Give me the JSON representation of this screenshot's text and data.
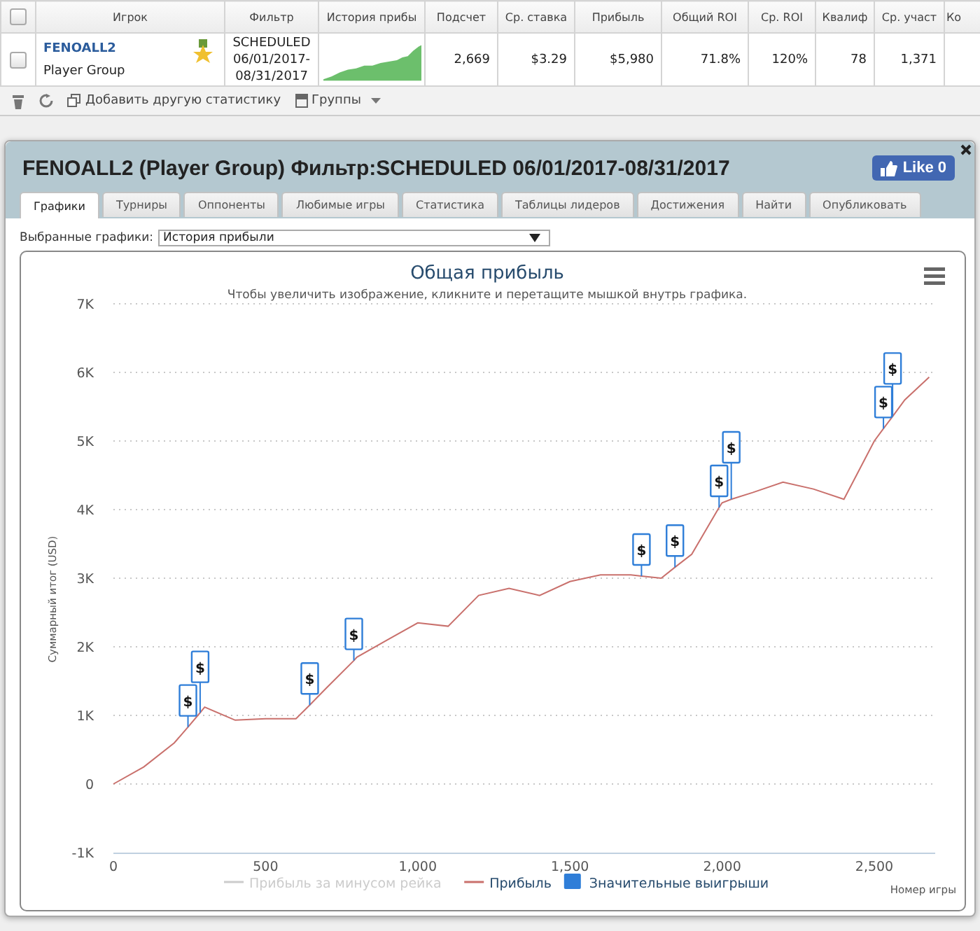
{
  "table": {
    "header_checked": false,
    "columns": [
      "Игрок",
      "Фильтр",
      "История прибы",
      "Подсчет",
      "Ср. ставка",
      "Прибыль",
      "Общий ROI",
      "Ср. ROI",
      "Квалиф",
      "Ср. участ",
      "Ко"
    ],
    "rows": [
      {
        "checked": false,
        "cells": [
          {
            "kind": "player",
            "name": "FENOALL2",
            "group": "Player Group"
          },
          {
            "kind": "filter",
            "lines": [
              "SCHEDULED",
              "06/01/2017-",
              "08/31/2017"
            ]
          },
          {
            "kind": "sparkline"
          },
          {
            "kind": "text",
            "text": "2,669"
          },
          {
            "kind": "text",
            "text": "$3.29"
          },
          {
            "kind": "text",
            "text": "$5,980"
          },
          {
            "kind": "text",
            "text": "71.8%"
          },
          {
            "kind": "text",
            "text": "120%"
          },
          {
            "kind": "text",
            "text": "78"
          },
          {
            "kind": "text",
            "text": "1,371"
          }
        ]
      }
    ]
  },
  "toolbar": [
    {
      "kind": "trash"
    },
    {
      "kind": "refresh"
    },
    {
      "kind": "add",
      "label": "Добавить другую статистику"
    },
    {
      "kind": "groups",
      "label": "Группы"
    }
  ],
  "dialog": {
    "title": "FENOALL2 (Player Group) Фильтр:SCHEDULED 06/01/2017-08/31/2017",
    "like": "Like 0",
    "tabs": [
      {
        "label": "Графики",
        "selected": true
      },
      {
        "label": "Турниры",
        "selected": false
      },
      {
        "label": "Оппоненты",
        "selected": false
      },
      {
        "label": "Любимые игры",
        "selected": false
      },
      {
        "label": "Статистика",
        "selected": false
      },
      {
        "label": "Таблицы лидеров",
        "selected": false
      },
      {
        "label": "Достижения",
        "selected": false
      },
      {
        "label": "Найти",
        "selected": false
      },
      {
        "label": "Опубликовать",
        "selected": false
      }
    ],
    "selector": {
      "label": "Выбранные графики:",
      "value": "История прибыли"
    },
    "chart": {
      "legend_items": [
        {
          "label": "Прибыль за минусом рейка",
          "kind": "line",
          "enabled": false
        },
        {
          "kind": "series",
          "enabled": true
        },
        {
          "label": "Значительные выигрыши",
          "kind": "flag",
          "enabled": true,
          "color": "#2f7ed8"
        }
      ],
      "chart_data": {
        "type": "line",
        "title": "Общая прибыль",
        "subtitle": "Чтобы увеличить изображение, кликните и перетащите мышкой внутрь графика.",
        "xlabel": "Номер игры",
        "ylabel": "Суммарный итог (USD)",
        "grid": true,
        "legend": "bottom",
        "x": [
          0,
          100,
          200,
          245,
          285,
          300,
          400,
          500,
          600,
          645,
          700,
          790,
          800,
          900,
          1000,
          1100,
          1200,
          1300,
          1400,
          1500,
          1600,
          1700,
          1735,
          1800,
          1845,
          1900,
          1990,
          2000,
          2030,
          2100,
          2200,
          2300,
          2400,
          2500,
          2530,
          2560,
          2600,
          2680
        ],
        "series": [
          {
            "name": "Прибыль",
            "color": "#c9706c",
            "values": [
              0,
              250,
              600,
              830,
              1040,
              1120,
              930,
              950,
              950,
              1150,
              1400,
              1800,
              1850,
              2100,
              2350,
              2300,
              2750,
              2850,
              2750,
              2950,
              3050,
              3050,
              3030,
              3000,
              3160,
              3350,
              4030,
              4100,
              4150,
              4250,
              4400,
              4300,
              4150,
              5000,
              5180,
              5360,
              5600,
              5930
            ]
          }
        ],
        "xlim": [
          0,
          2700
        ],
        "ylim": [
          -1000,
          7000
        ],
        "xticks": [
          0,
          500,
          {
            "value": 1000,
            "label": "1,000"
          },
          {
            "value": 1500,
            "label": "1,500"
          },
          {
            "value": 2000,
            "label": "2,000"
          },
          {
            "value": 2500,
            "label": "2,500"
          }
        ],
        "yticks": [
          {
            "value": -1000,
            "label": "-1K"
          },
          0,
          {
            "value": 1000,
            "label": "1K"
          },
          {
            "value": 2000,
            "label": "2K"
          },
          {
            "value": 3000,
            "label": "3K"
          },
          {
            "value": 4000,
            "label": "4K"
          },
          {
            "value": 5000,
            "label": "5K"
          },
          {
            "value": 6000,
            "label": "6K"
          },
          {
            "value": 7000,
            "label": "7K"
          }
        ],
        "annotations": [
          {
            "x": 245,
            "y": 830,
            "text": "$"
          },
          {
            "x": 285,
            "y": 1040,
            "text": "$"
          },
          {
            "x": 645,
            "y": 1150,
            "text": "$"
          },
          {
            "x": 790,
            "y": 1800,
            "text": "$"
          },
          {
            "x": 1735,
            "y": 3030,
            "text": "$"
          },
          {
            "x": 1845,
            "y": 3160,
            "text": "$"
          },
          {
            "x": 1990,
            "y": 4030,
            "text": "$"
          },
          {
            "x": 2030,
            "y": 4150,
            "text": "$"
          },
          {
            "x": 2530,
            "y": 5180,
            "text": "$"
          },
          {
            "x": 2560,
            "y": 5360,
            "text": "$"
          }
        ]
      }
    }
  }
}
